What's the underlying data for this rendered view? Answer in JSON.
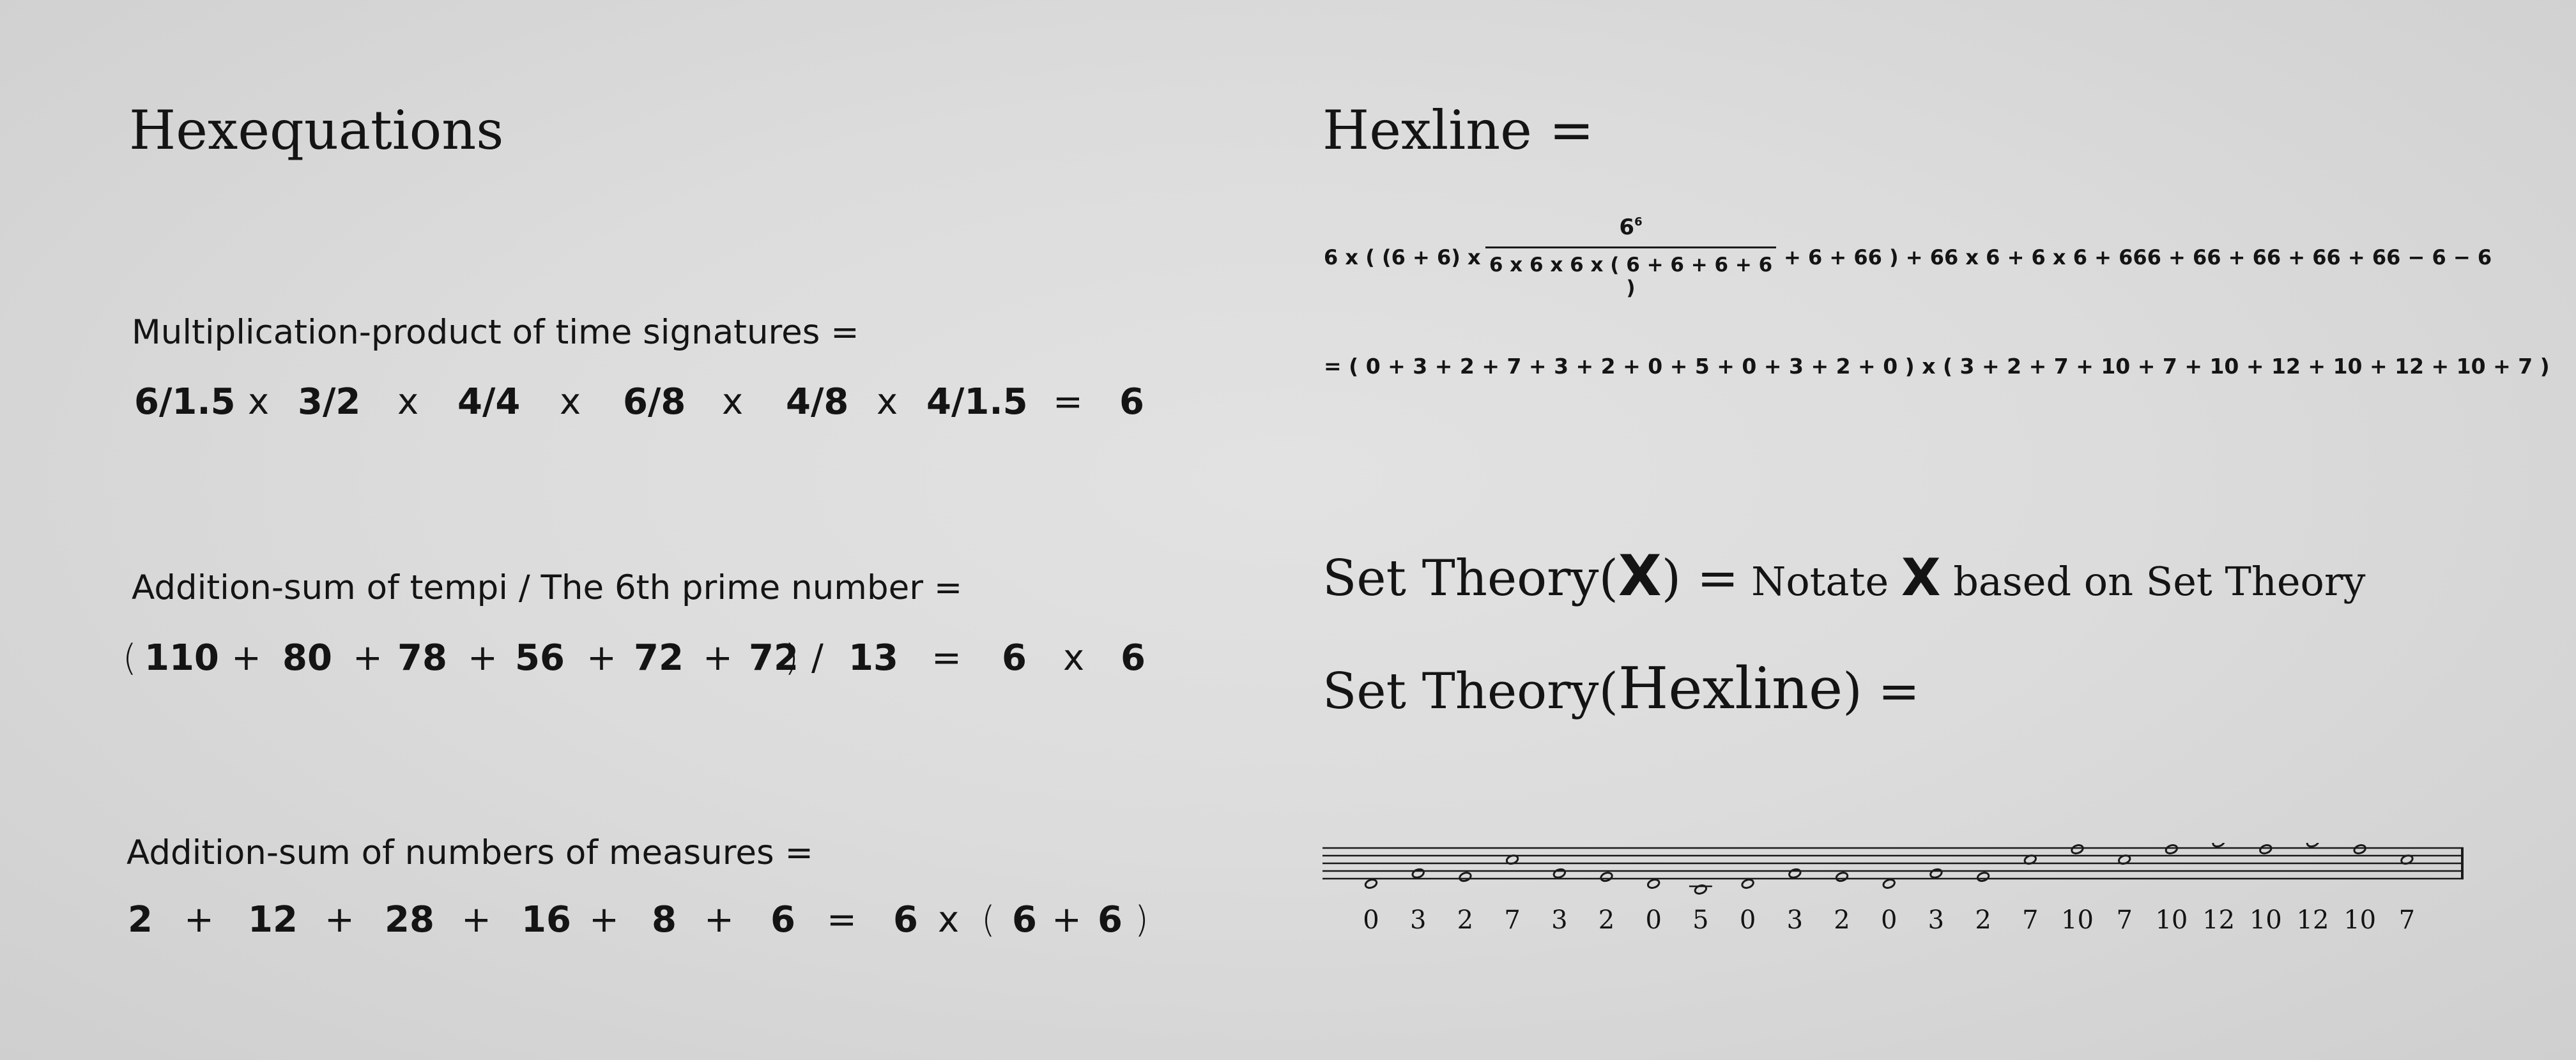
{
  "left": {
    "title": "Hexequations",
    "eq1": {
      "caption": "Multiplication-product of time signatures =",
      "tokens": [
        "6/1.5",
        "x",
        "3/2",
        "x",
        "4/4",
        "x",
        "6/8",
        "x",
        "4/8",
        "x",
        "4/1.5",
        "=",
        "6"
      ]
    },
    "eq2": {
      "caption": "Addition-sum of tempi / The 6th prime number =",
      "tokens": [
        "(",
        "110",
        "+",
        "80",
        "+",
        "78",
        "+",
        "56",
        "+",
        "72",
        "+",
        "72",
        ")",
        "/",
        "13",
        "=",
        "6",
        "x",
        "6"
      ]
    },
    "eq3": {
      "caption": "Addition-sum of numbers of measures =",
      "tokens": [
        "2",
        "+",
        "12",
        "+",
        "28",
        "+",
        "16",
        "+",
        "8",
        "+",
        "6",
        "=",
        "6",
        "x",
        "(",
        "6",
        "+",
        "6",
        ")"
      ]
    }
  },
  "right": {
    "title": "Hexline =",
    "line1": {
      "prefix": "6 x ( (6 + 6)  x",
      "fraction_numerator_base": "6",
      "fraction_numerator_exp": "6",
      "fraction_denominator": "6 x 6 x 6 x ( 6 + 6 + 6 + 6 )",
      "suffix": "+ 6 + 66 )  + 66 x 6 + 6 x 6 + 666 + 66 + 66 + 66 + 66 − 6 − 6"
    },
    "line2": "=  ( 0 + 3 + 2 + 7 + 3 + 2 + 0 + 5 + 0 + 3 + 2 + 0 ) x ( 3 + 2 + 7 + 10 + 7 + 10 + 12 + 10 + 12 + 10 + 7 )",
    "set_def": {
      "head": "Set Theory(",
      "var": "X",
      "close": ") =",
      "desc_a": " Notate ",
      "desc_var": "X",
      "desc_b": " based on Set Theory"
    },
    "set_apply": {
      "head": "Set Theory(",
      "arg": "Hexline",
      "close": ") ="
    },
    "staff_numbers": [
      "0",
      "3",
      "2",
      "7",
      "3",
      "2",
      "0",
      "5",
      "0",
      "3",
      "2",
      "0",
      "3",
      "2",
      "7",
      "10",
      "7",
      "10",
      "12",
      "10",
      "12",
      "10",
      "7"
    ]
  }
}
